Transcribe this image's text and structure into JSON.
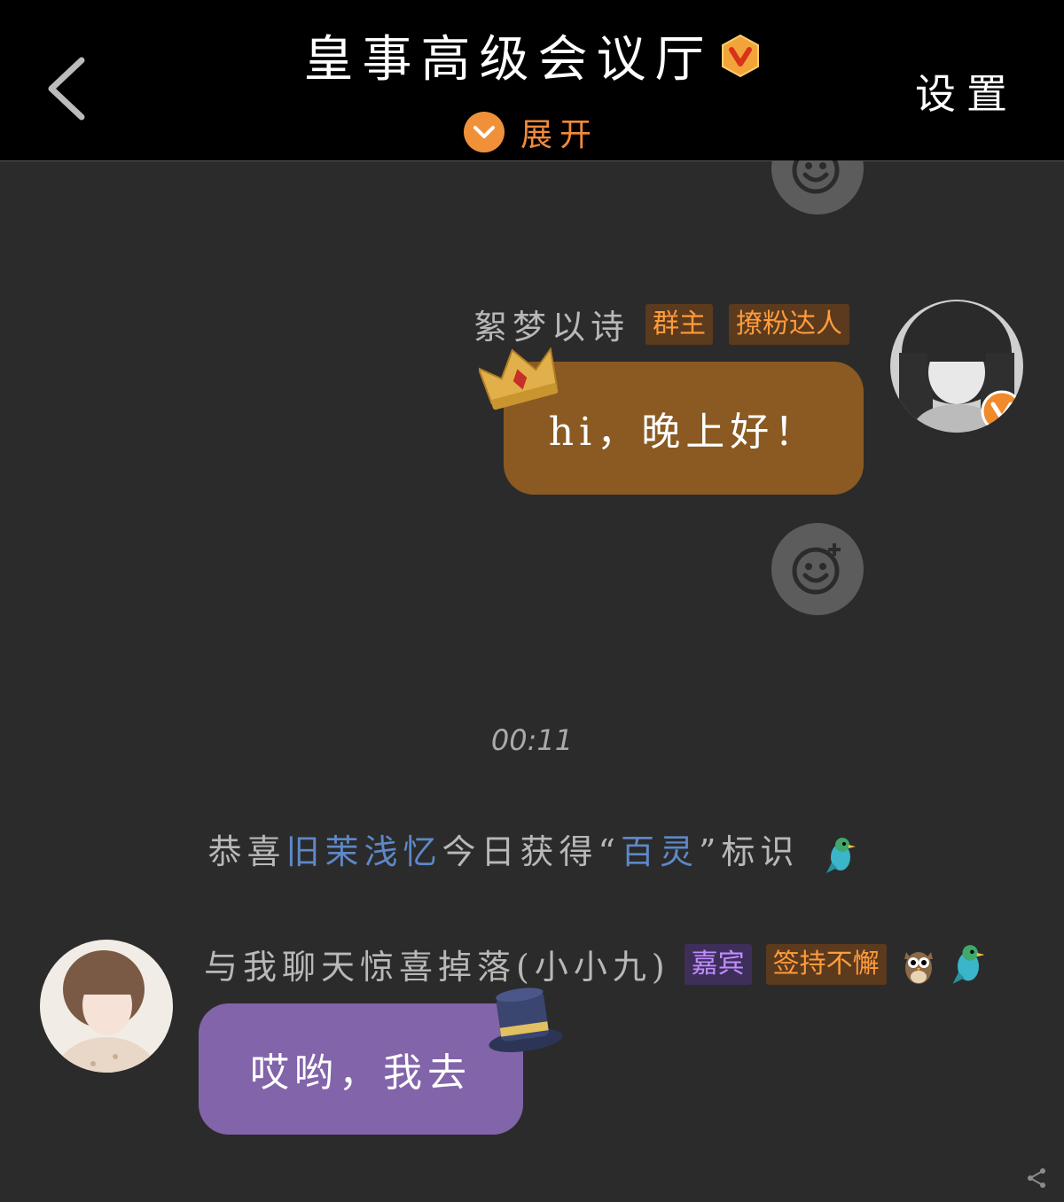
{
  "header": {
    "title": "皇事高级会议厅",
    "expand_label": "展开",
    "settings_label": "设置",
    "accent_color": "#f0913a"
  },
  "icons": {
    "back": "chevron-left-icon",
    "verified": "v-badge-icon",
    "expand": "chevron-down-icon",
    "emoji": "smile-plus-icon"
  },
  "messages": [
    {
      "sender": "絮梦以诗",
      "tags": [
        "群主",
        "撩粉达人"
      ],
      "text": "hi，晚上好！",
      "side": "right",
      "bubble_color": "#8a5a22"
    },
    {
      "sender": "与我聊天惊喜掉落(小小九)",
      "tags": [
        "嘉宾",
        "签持不懈"
      ],
      "text": "哎哟，我去",
      "side": "left",
      "bubble_color": "#8264aa"
    }
  ],
  "time_divider": "00:11",
  "system_notice": {
    "prefix": "恭喜",
    "user": "旧茉浅忆",
    "middle": "今日获得“",
    "badge": "百灵",
    "suffix": "”标识"
  }
}
